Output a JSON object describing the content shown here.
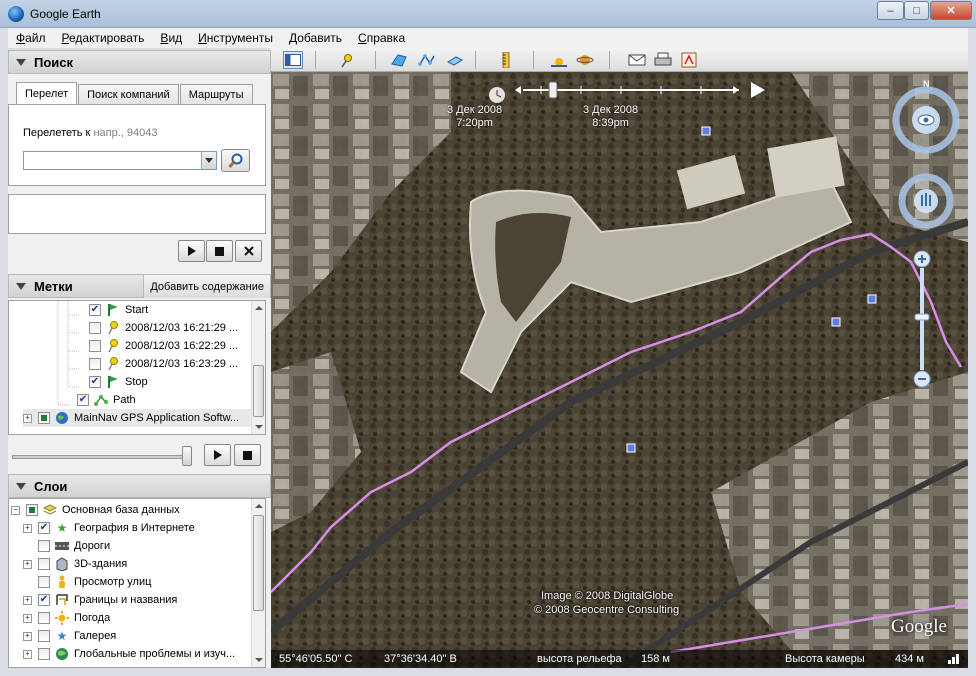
{
  "window": {
    "title": "Google Earth",
    "minimize": "–",
    "maximize": "□",
    "close": "✕"
  },
  "menu": [
    "Файл",
    "Редактировать",
    "Вид",
    "Инструменты",
    "Добавить",
    "Справка"
  ],
  "search": {
    "header": "Поиск",
    "tabs": [
      "Перелет",
      "Поиск компаний",
      "Маршруты"
    ],
    "fly_to_label": "Перелететь к",
    "fly_to_hint": "напр., 94043",
    "input_value": ""
  },
  "places": {
    "header": "Метки",
    "add_content": "Добавить содержание",
    "items": [
      {
        "label": "Start",
        "icon": "start-flag-icon",
        "checked": true
      },
      {
        "label": "2008/12/03 16:21:29 ...",
        "icon": "pushpin-icon",
        "checked": false
      },
      {
        "label": "2008/12/03 16:22:29 ...",
        "icon": "pushpin-icon",
        "checked": false
      },
      {
        "label": "2008/12/03 16:23:29 ...",
        "icon": "pushpin-icon",
        "checked": false
      },
      {
        "label": "Stop",
        "icon": "stop-flag-icon",
        "checked": true
      },
      {
        "label": "Path",
        "icon": "path-icon",
        "checked": true
      },
      {
        "label": "MainNav GPS Application Softw...",
        "icon": "earth-icon",
        "checked": "partial"
      }
    ]
  },
  "layers": {
    "header": "Слои",
    "items": [
      {
        "label": "Основная база данных",
        "icon": "database-icon",
        "checked": "partial"
      },
      {
        "label": "География в Интернете",
        "icon": "star-icon",
        "checked": true
      },
      {
        "label": "Дороги",
        "icon": "road-icon",
        "checked": false
      },
      {
        "label": "3D-здания",
        "icon": "building-icon",
        "checked": false
      },
      {
        "label": "Просмотр улиц",
        "icon": "pegman-icon",
        "checked": false
      },
      {
        "label": "Границы и названия",
        "icon": "borders-icon",
        "checked": true
      },
      {
        "label": "Погода",
        "icon": "sun-icon",
        "checked": false
      },
      {
        "label": "Галерея",
        "icon": "star-icon",
        "checked": false
      },
      {
        "label": "Глобальные проблемы и изуч...",
        "icon": "globe-icon",
        "checked": false
      }
    ]
  },
  "timeline": {
    "start_date": "3 Дек 2008",
    "start_time": "7:20pm",
    "end_date": "3 Дек 2008",
    "end_time": "8:39pm"
  },
  "attribution": [
    "Image © 2008 DigitalGlobe",
    "© 2008 Geocentre Consulting"
  ],
  "logo": "Google",
  "status": {
    "lat": "55°46'05.50\" С",
    "lon": "37°36'34.40\" В",
    "elev_label": "высота рельефа",
    "elev_value": "158 м",
    "cam_label": "Высота камеры",
    "cam_value": "434 м"
  },
  "colors": {
    "path": "#d68fe6",
    "accent": "#2d5c9f"
  }
}
